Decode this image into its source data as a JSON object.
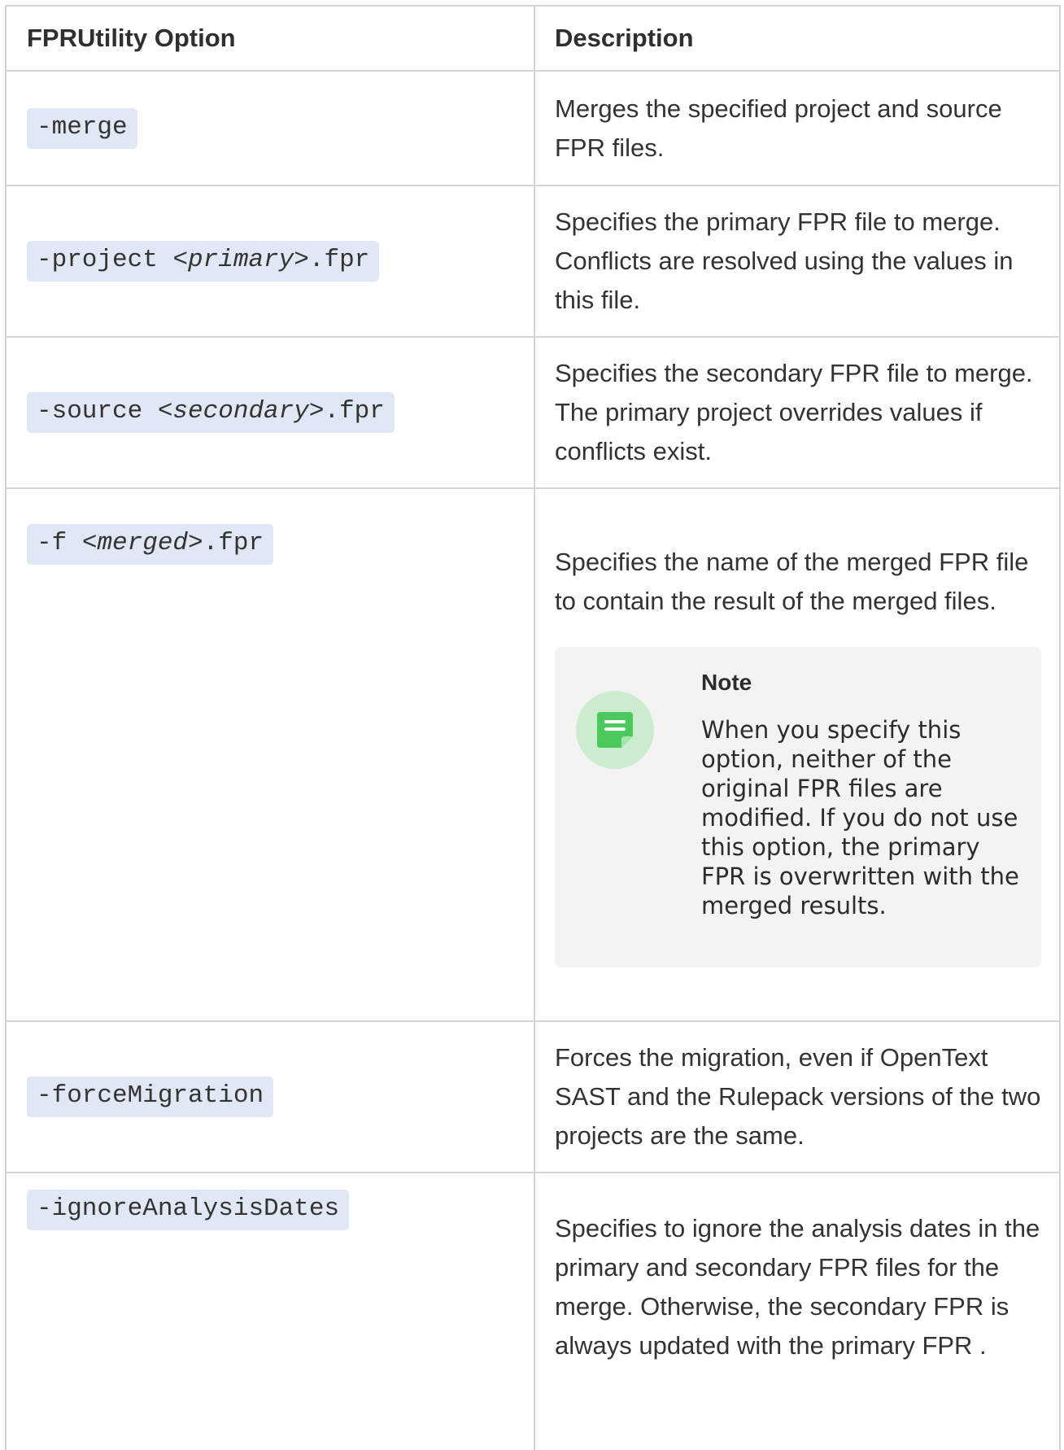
{
  "table": {
    "header": {
      "col1": "FPRUtility Option",
      "col2": "Description"
    },
    "rows": [
      {
        "option_pre": "-merge",
        "option_var": "",
        "option_post": "",
        "description": "Merges the specified project and source FPR files."
      },
      {
        "option_pre": "-project ",
        "option_var": "<primary>",
        "option_post": ".fpr",
        "description": "Specifies the primary FPR file to merge. Conflicts are resolved using the values in this file."
      },
      {
        "option_pre": "-source ",
        "option_var": "<secondary>",
        "option_post": ".fpr",
        "description": "Specifies the secondary FPR file to merge. The primary project overrides values if conflicts exist."
      },
      {
        "option_pre": "-f ",
        "option_var": "<merged>",
        "option_post": ".fpr",
        "description": "Specifies the name of the merged FPR file to contain the result of the merged files.",
        "note": {
          "title": "Note",
          "icon": "note-icon",
          "text": "When you specify this option, neither of the original FPR files are modified. If you do not use this option, the primary FPR is overwritten with the merged results."
        }
      },
      {
        "option_pre": "-forceMigration",
        "option_var": "",
        "option_post": "",
        "description": "Forces the migration, even if OpenText SAST and the Rulepack versions of the two projects are the same."
      },
      {
        "option_pre": "-ignoreAnalysisDates",
        "option_var": "",
        "option_post": "",
        "description": "Specifies to ignore the analysis dates in the primary and secondary FPR files for the merge. Otherwise, the secondary FPR is always updated with the primary FPR ."
      }
    ]
  },
  "colors": {
    "code_background": "#e1e8f5",
    "note_background": "#f3f3f3",
    "note_icon_circle": "#cbeccf",
    "note_icon_fill": "#4cc95c",
    "border": "#d4d4d4"
  }
}
